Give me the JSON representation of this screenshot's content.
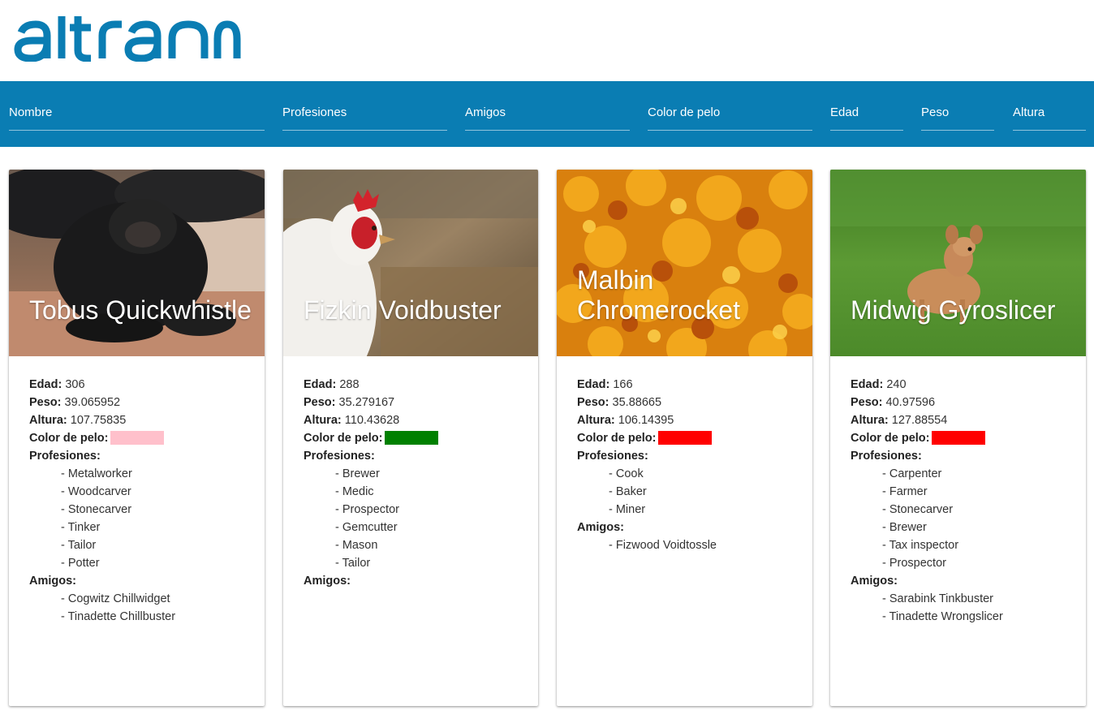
{
  "brand": {
    "logo_text": "altran",
    "color": "#0a7db3",
    "bar_color": "#0a7db3"
  },
  "filters": [
    {
      "placeholder": "Nombre"
    },
    {
      "placeholder": "Profesiones"
    },
    {
      "placeholder": "Amigos"
    },
    {
      "placeholder": "Color de pelo"
    },
    {
      "placeholder": "Edad"
    },
    {
      "placeholder": "Peso"
    },
    {
      "placeholder": "Altura"
    }
  ],
  "labels": {
    "age": "Edad:",
    "weight": "Peso:",
    "height": "Altura:",
    "hair": "Color de pelo:",
    "professions": "Profesiones:",
    "friends": "Amigos:"
  },
  "cards": [
    {
      "name": "Tobus Quickwhistle",
      "image": "chimpanzee-photo",
      "age": "306",
      "weight": "39.065952",
      "height": "107.75835",
      "hair_color": "#ffc0cb",
      "professions": [
        "- Metalworker",
        "- Woodcarver",
        "- Stonecarver",
        "- Tinker",
        "- Tailor",
        "- Potter"
      ],
      "friends": [
        "- Cogwitz Chillwidget",
        "- Tinadette Chillbuster"
      ]
    },
    {
      "name": "Fizkin Voidbuster",
      "image": "rooster-photo",
      "age": "288",
      "weight": "35.279167",
      "height": "110.43628",
      "hair_color": "#008000",
      "professions": [
        "- Brewer",
        "- Medic",
        "- Prospector",
        "- Gemcutter",
        "- Mason",
        "- Tailor"
      ],
      "friends": []
    },
    {
      "name": "Malbin Chromerocket",
      "image": "autumn-leaves-photo",
      "age": "166",
      "weight": "35.88665",
      "height": "106.14395",
      "hair_color": "#ff0000",
      "professions": [
        "- Cook",
        "- Baker",
        "- Miner"
      ],
      "friends": [
        "- Fizwood Voidtossle"
      ]
    },
    {
      "name": "Midwig Gyroslicer",
      "image": "fawn-on-grass-photo",
      "age": "240",
      "weight": "40.97596",
      "height": "127.88554",
      "hair_color": "#ff0000",
      "professions": [
        "- Carpenter",
        "- Farmer",
        "- Stonecarver",
        "- Brewer",
        "- Tax inspector",
        "- Prospector"
      ],
      "friends": [
        "- Sarabink Tinkbuster",
        "- Tinadette Wrongslicer"
      ]
    }
  ]
}
